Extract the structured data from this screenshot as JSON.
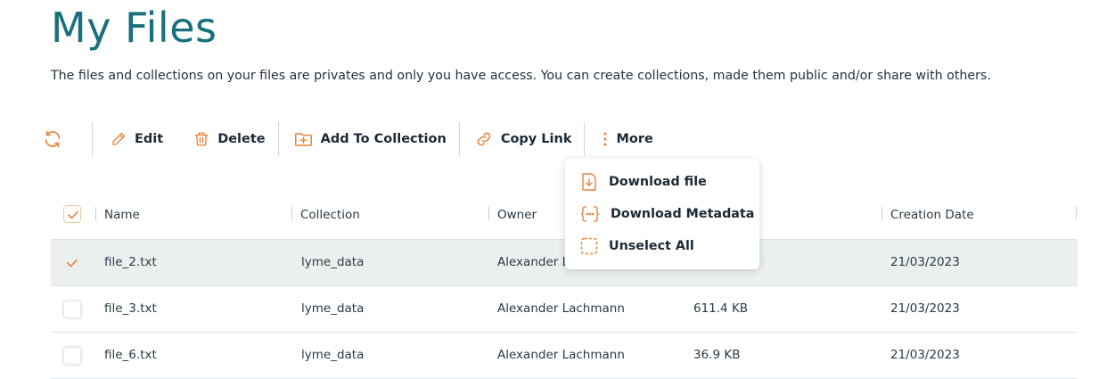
{
  "page": {
    "title": "My Files",
    "description": "The files and collections on your files are privates and only you have access. You can create collections, made them public and/or share with others."
  },
  "toolbar": {
    "edit_label": "Edit",
    "delete_label": "Delete",
    "add_to_collection_label": "Add To Collection",
    "copy_link_label": "Copy Link",
    "more_label": "More"
  },
  "more_menu": {
    "items": [
      {
        "label": "Download file",
        "icon": "download-file-icon"
      },
      {
        "label": "Download Metadata",
        "icon": "metadata-braces-icon"
      },
      {
        "label": "Unselect All",
        "icon": "dashed-square-icon"
      }
    ]
  },
  "table": {
    "columns": [
      "Name",
      "Collection",
      "Owner",
      "Creation Date"
    ],
    "rows": [
      {
        "name": "file_2.txt",
        "collection": "lyme_data",
        "owner": "Alexander La",
        "size": "",
        "date": "21/03/2023",
        "selected": true
      },
      {
        "name": "file_3.txt",
        "collection": "lyme_data",
        "owner": "Alexander Lachmann",
        "size": "611.4 KB",
        "date": "21/03/2023",
        "selected": false
      },
      {
        "name": "file_6.txt",
        "collection": "lyme_data",
        "owner": "Alexander Lachmann",
        "size": "36.9 KB",
        "date": "21/03/2023",
        "selected": false
      }
    ]
  },
  "colors": {
    "title": "#17707e",
    "accent": "#e8833a",
    "selected_row": "#ebf0ee"
  }
}
